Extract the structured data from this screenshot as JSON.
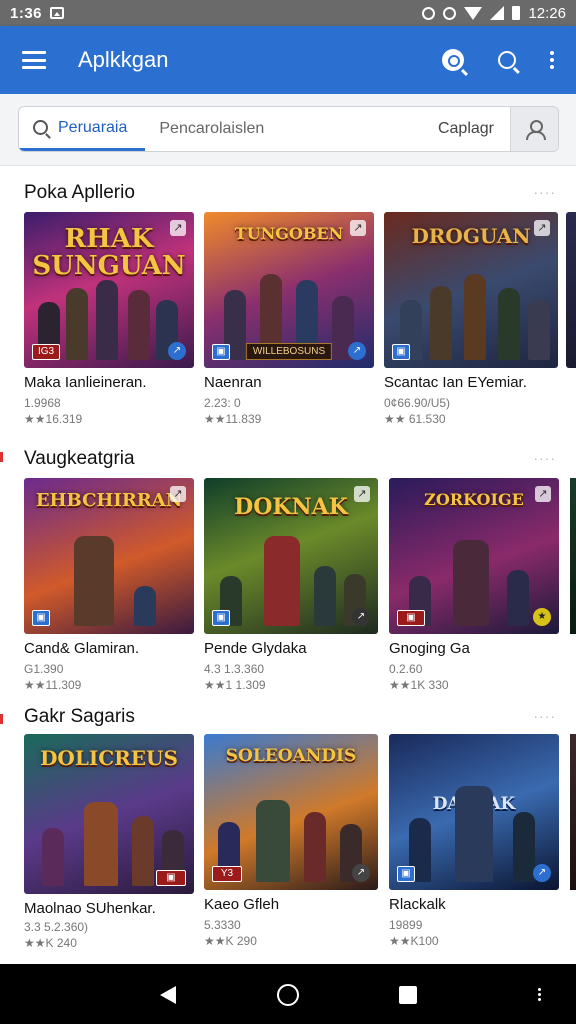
{
  "status_bar": {
    "time_left": "1:36",
    "time_right": "12:26"
  },
  "app_bar": {
    "title": "Aplkkgan"
  },
  "search": {
    "active_tab": "Peruaraia",
    "placeholder": "Pencarolaislen",
    "right_label": "Caplagr"
  },
  "sections": [
    {
      "title": "Poka Apllerio",
      "more": "····",
      "apps": [
        {
          "name": "Maka Ianlieineran.",
          "sub": "1.9968",
          "rating": "★★16.319",
          "art_title": "RHAK SUNGUAN",
          "ribbon": "",
          "badge": "IG3"
        },
        {
          "name": "Naenran",
          "sub": "2.23: 0",
          "rating": "★★11.839",
          "art_title": "TUNGOBEN",
          "ribbon": "WILLEBOSUNS",
          "badge": ""
        },
        {
          "name": "Scantac Ian EYemiar.",
          "sub": "0¢66.90/U5)",
          "rating": "★★ 61.530",
          "art_title": "DROGUAN",
          "ribbon": "",
          "badge": ""
        }
      ]
    },
    {
      "title": "Vaugkeatgria",
      "more": "····",
      "apps": [
        {
          "name": "Cand& Glamiran.",
          "sub": "G1.390",
          "rating": "★★11.309",
          "art_title": "EHBCHIRRAN",
          "ribbon": "",
          "badge": ""
        },
        {
          "name": "Pende Glydaka",
          "sub": "4.3 1.3.360",
          "rating": "★★1 1.309",
          "art_title": "DOKNAK",
          "ribbon": "",
          "badge": ""
        },
        {
          "name": "Gnoging Ga",
          "sub": "0.2.60",
          "rating": "★★1K 330",
          "art_title": "ZORKOIGE",
          "ribbon": "",
          "badge": ""
        }
      ]
    },
    {
      "title": "Gakr Sagaris",
      "more": "····",
      "apps": [
        {
          "name": "Maolnao SUhenkar.",
          "sub": "3.3 5.2.360)",
          "rating": "★★K 240",
          "art_title": "DOLICREUS",
          "ribbon": "",
          "badge": ""
        },
        {
          "name": "Kaeo Gfleh",
          "sub": "5.3330",
          "rating": "★★K 290",
          "art_title": "SOLEOANDIS",
          "ribbon": "",
          "badge": "Y3"
        },
        {
          "name": "Rlackalk",
          "sub": "19899",
          "rating": "★★K100",
          "art_title": "DACAAK",
          "ribbon": "",
          "badge": ""
        }
      ]
    }
  ],
  "colors": {
    "app_bar": "#2b6fd1",
    "status_bar": "#6a6a6a",
    "nav_bar": "#000000"
  }
}
